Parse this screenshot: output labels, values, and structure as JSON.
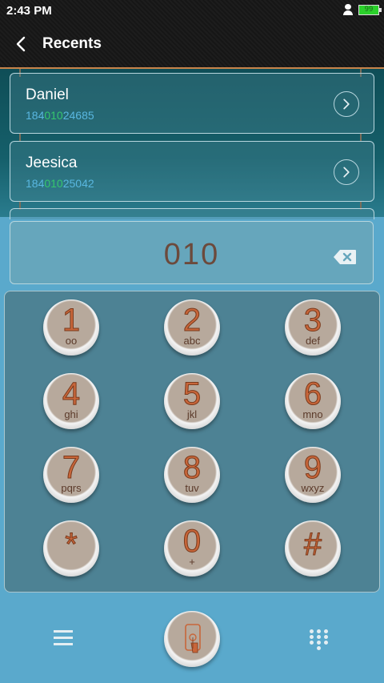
{
  "status_bar": {
    "time": "2:43 PM",
    "battery_level": "99"
  },
  "header": {
    "title": "Recents",
    "back_icon": "chevron-left-icon"
  },
  "recents": [
    {
      "name": "Daniel",
      "number_prefix": "184",
      "number_match": "010",
      "number_suffix": "24685"
    },
    {
      "name": "Jeesica",
      "number_prefix": "184",
      "number_match": "010",
      "number_suffix": "25042"
    }
  ],
  "dial_display": {
    "value": "010",
    "backspace_icon": "backspace-icon"
  },
  "keypad": {
    "keys": [
      {
        "digit": "1",
        "letters": "oo"
      },
      {
        "digit": "2",
        "letters": "abc"
      },
      {
        "digit": "3",
        "letters": "def"
      },
      {
        "digit": "4",
        "letters": "ghi"
      },
      {
        "digit": "5",
        "letters": "jkl"
      },
      {
        "digit": "6",
        "letters": "mno"
      },
      {
        "digit": "7",
        "letters": "pqrs"
      },
      {
        "digit": "8",
        "letters": "tuv"
      },
      {
        "digit": "9",
        "letters": "wxyz"
      },
      {
        "digit": "*",
        "letters": ""
      },
      {
        "digit": "0",
        "letters": "+"
      },
      {
        "digit": "#",
        "letters": ""
      }
    ]
  },
  "bottom_bar": {
    "menu_icon": "menu-icon",
    "call_icon": "phone-touch-icon",
    "keypad_icon": "dialpad-icon"
  },
  "colors": {
    "accent_orange": "#c8663a",
    "match_green": "#36c66e",
    "number_blue": "#59b7e0",
    "background_blue": "#5aa9cc"
  }
}
